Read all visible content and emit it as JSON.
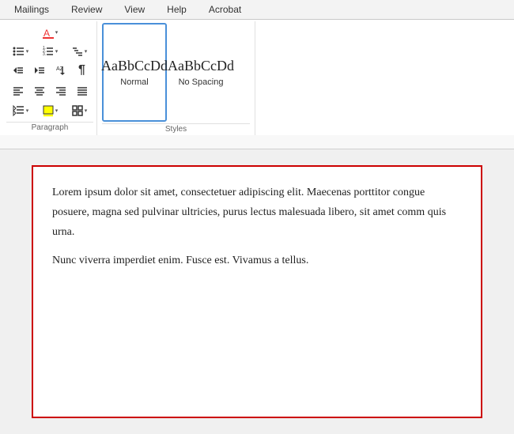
{
  "tabs": [
    {
      "label": "Mailings"
    },
    {
      "label": "Review"
    },
    {
      "label": "View"
    },
    {
      "label": "Help"
    },
    {
      "label": "Acrobat"
    }
  ],
  "toolbar": {
    "paragraph_label": "Paragraph",
    "styles_label": "Styles"
  },
  "styles": {
    "normal_label": "Normal",
    "nospacing_label": "No Spacing"
  },
  "document": {
    "paragraph1": "Lorem ipsum dolor sit amet, consectetuer adipiscing elit. Maecenas porttitor congue posuere, magna sed pulvinar ultricies, purus lectus malesuada libero, sit amet comm quis urna.",
    "paragraph2": "Nunc viverra imperdiet enim. Fusce est. Vivamus a tellus."
  },
  "colors": {
    "accent_blue": "#4a90d9",
    "border_red": "#cc0000",
    "tab_bg": "#f3f3f3"
  }
}
